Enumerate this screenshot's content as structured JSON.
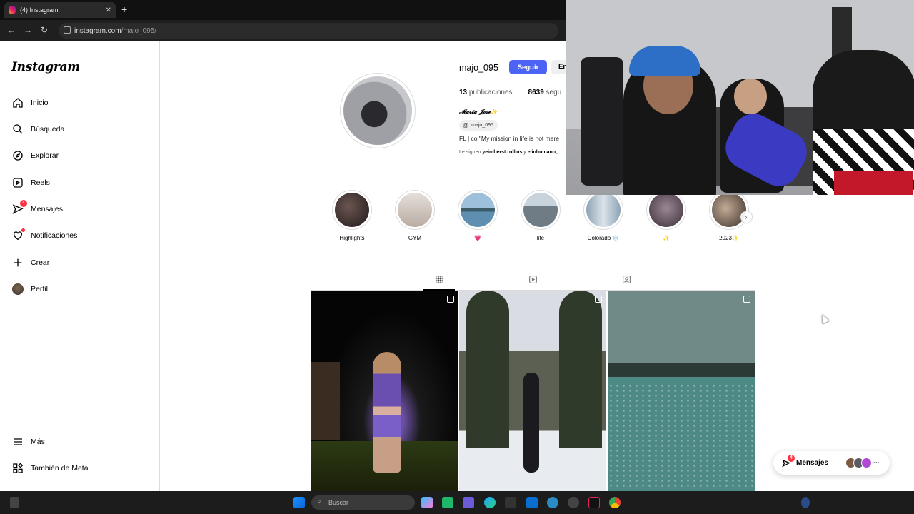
{
  "browser": {
    "tab_title": "(4) Instagram",
    "tab_close": "✕",
    "new_tab": "+",
    "url_domain": "instagram.com",
    "url_path": "/majo_095/"
  },
  "sidebar": {
    "logo": "Instagram",
    "items": [
      {
        "label": "Inicio",
        "icon": "home-icon"
      },
      {
        "label": "Búsqueda",
        "icon": "search-icon"
      },
      {
        "label": "Explorar",
        "icon": "compass-icon"
      },
      {
        "label": "Reels",
        "icon": "reels-icon"
      },
      {
        "label": "Mensajes",
        "icon": "messenger-icon",
        "badge": "4"
      },
      {
        "label": "Notificaciones",
        "icon": "heart-icon"
      },
      {
        "label": "Crear",
        "icon": "plus-icon"
      },
      {
        "label": "Perfil",
        "icon": "avatar"
      }
    ],
    "more_label": "Más",
    "meta_label": "También de Meta"
  },
  "profile": {
    "username": "majo_095",
    "follow_label": "Seguir",
    "message_label": "En",
    "posts_count": "13",
    "posts_label": "publicaciones",
    "followers_count": "8639",
    "followers_label": "segu",
    "full_name": "𝓜𝓪𝓻𝓲𝓪 𝓙𝓸𝓼𝓮✨",
    "threads_handle": "majo_095",
    "bio": "FL | co \"My mission in life is not mere",
    "followed_by_prefix": "Le siguen ",
    "followed_by_1": "yeimberst.rollins",
    "followed_by_and": " y ",
    "followed_by_2": "elinhumano_"
  },
  "highlights": [
    {
      "label": "Highlights",
      "color": "#3b2f2f"
    },
    {
      "label": "GYM",
      "color": "#d9cfc8"
    },
    {
      "label": "💗",
      "color": "#5f8fb0"
    },
    {
      "label": "life",
      "color": "#8a98a6"
    },
    {
      "label": "Colorado ❄️",
      "color": "#b7c4cf"
    },
    {
      "label": "✨",
      "color": "#5c4d5a"
    },
    {
      "label": "2023✨",
      "color": "#4a3f3a"
    }
  ],
  "floating_messages": {
    "label": "Mensajes",
    "badge": "4",
    "more": "···"
  },
  "taskbar": {
    "search_placeholder": "Buscar"
  }
}
